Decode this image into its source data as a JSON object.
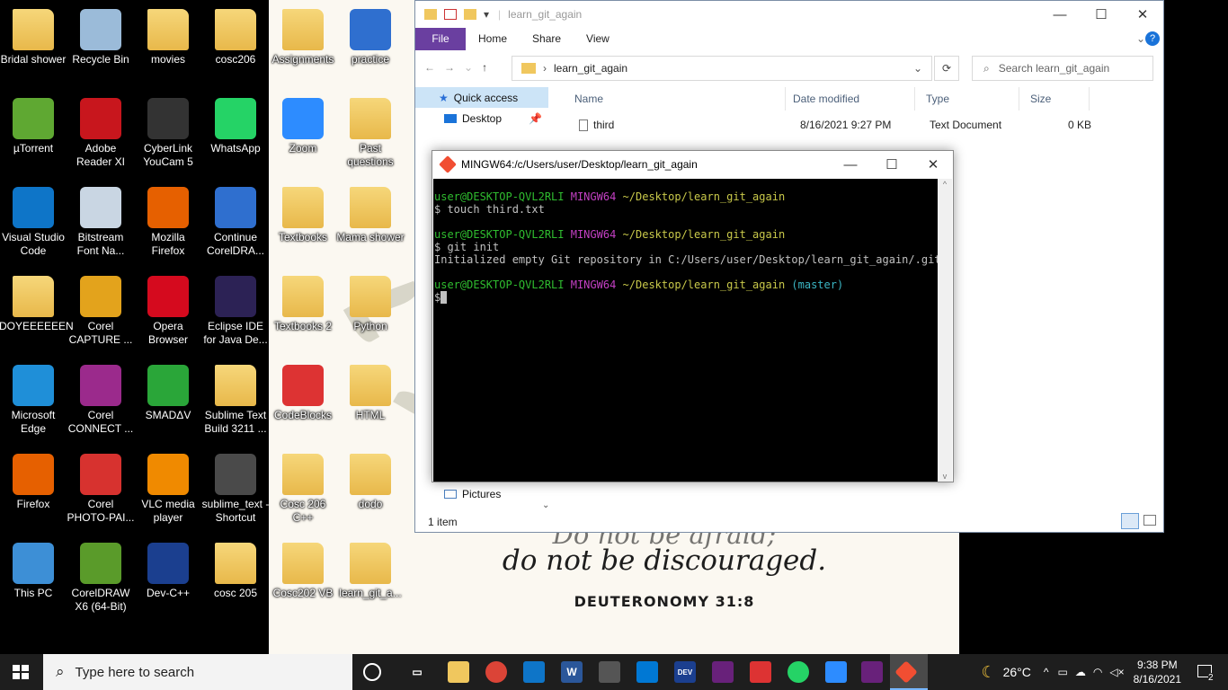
{
  "desktop_left_icons": [
    {
      "label": "Bridal shower",
      "icon": "image-folder-icon",
      "color": "#e9c06a"
    },
    {
      "label": "Recycle Bin",
      "icon": "recycle-bin-icon",
      "color": "#9bbbd9"
    },
    {
      "label": "movies",
      "icon": "folder-icon",
      "color": "#f0c75e"
    },
    {
      "label": "cosc206",
      "icon": "folder-icon",
      "color": "#f0c75e"
    },
    {
      "label": "µTorrent",
      "icon": "utorrent-icon",
      "color": "#5fa832"
    },
    {
      "label": "Adobe Reader XI",
      "icon": "adobe-reader-icon",
      "color": "#c8161d"
    },
    {
      "label": "CyberLink YouCam 5",
      "icon": "youcam-icon",
      "color": "#333333"
    },
    {
      "label": "WhatsApp",
      "icon": "whatsapp-icon",
      "color": "#25d366"
    },
    {
      "label": "Visual Studio Code",
      "icon": "vscode-icon",
      "color": "#0e75c8"
    },
    {
      "label": "Bitstream Font Na...",
      "icon": "font-navigator-icon",
      "color": "#c9d6e3"
    },
    {
      "label": "Mozilla Firefox",
      "icon": "firefox-icon",
      "color": "#e66000"
    },
    {
      "label": "Continue CorelDRA...",
      "icon": "document-icon",
      "color": "#2f6fcf"
    },
    {
      "label": "DOYEEEEEEN",
      "icon": "user-folder-icon",
      "color": "#e8b84a"
    },
    {
      "label": "Corel CAPTURE ...",
      "icon": "corel-capture-icon",
      "color": "#e3a31c"
    },
    {
      "label": "Opera Browser",
      "icon": "opera-icon",
      "color": "#d50a1e"
    },
    {
      "label": "Eclipse IDE for Java De...",
      "icon": "eclipse-icon",
      "color": "#2c2255"
    },
    {
      "label": "Microsoft Edge",
      "icon": "edge-icon",
      "color": "#1f8fd8"
    },
    {
      "label": "Corel CONNECT ...",
      "icon": "corel-connect-icon",
      "color": "#9b2a8c"
    },
    {
      "label": "SMADΔV",
      "icon": "smadav-icon",
      "color": "#2aa639"
    },
    {
      "label": "Sublime Text Build 3211 ...",
      "icon": "zip-folder-icon",
      "color": "#e8b84a"
    },
    {
      "label": "Firefox",
      "icon": "firefox-icon",
      "color": "#e66000"
    },
    {
      "label": "Corel PHOTO-PAI...",
      "icon": "corel-photopaint-icon",
      "color": "#d7322f"
    },
    {
      "label": "VLC media player",
      "icon": "vlc-icon",
      "color": "#f08a00"
    },
    {
      "label": "sublime_text - Shortcut",
      "icon": "sublime-icon",
      "color": "#4a4a4a"
    },
    {
      "label": "This PC",
      "icon": "this-pc-icon",
      "color": "#3d8fd6"
    },
    {
      "label": "CorelDRAW X6 (64-Bit)",
      "icon": "coreldraw-icon",
      "color": "#5a9b2a"
    },
    {
      "label": "Dev-C++",
      "icon": "devcpp-icon",
      "color": "#1b3f8f"
    },
    {
      "label": "cosc 205",
      "icon": "folder-icon",
      "color": "#e8b84a"
    }
  ],
  "desktop_right_icons": [
    {
      "label": "Assignments",
      "icon": "folder-icon",
      "color": "#e8b84a"
    },
    {
      "label": "practice",
      "icon": "screenshot-icon",
      "color": "#2f6fcf"
    },
    {
      "label": "Zoom",
      "icon": "zoom-icon",
      "color": "#2d8cff"
    },
    {
      "label": "Past questions",
      "icon": "folder-icon",
      "color": "#e8b84a"
    },
    {
      "label": "Textbooks",
      "icon": "folder-icon",
      "color": "#e8b84a"
    },
    {
      "label": "Mama shower",
      "icon": "image-folder-icon",
      "color": "#c99a6a"
    },
    {
      "label": "Textbooks 2",
      "icon": "folder-icon",
      "color": "#e8b84a"
    },
    {
      "label": "Python",
      "icon": "folder-icon",
      "color": "#e8b84a"
    },
    {
      "label": "CodeBlocks",
      "icon": "codeblocks-icon",
      "color": "#d33"
    },
    {
      "label": "HTML",
      "icon": "folder-icon",
      "color": "#e8b84a"
    },
    {
      "label": "Cosc 206 C++",
      "icon": "folder-icon",
      "color": "#e8b84a"
    },
    {
      "label": "dodo",
      "icon": "folder-icon",
      "color": "#e8b84a"
    },
    {
      "label": "Cosc202 VB",
      "icon": "folder-icon",
      "color": "#e8b84a"
    },
    {
      "label": "learn_git_a...",
      "icon": "folder-icon",
      "color": "#e8b84a"
    }
  ],
  "wallpaper": {
    "line1": "Do not be afraid;",
    "line2": "do not be discouraged.",
    "reference": "DEUTERONOMY 31:8"
  },
  "explorer": {
    "title": "learn_git_again",
    "ribbon_tabs": [
      "File",
      "Home",
      "Share",
      "View"
    ],
    "address": "learn_git_again",
    "search_placeholder": "Search learn_git_again",
    "nav_items": [
      {
        "label": "Quick access",
        "icon": "star-icon"
      },
      {
        "label": "Desktop",
        "icon": "desktop-icon"
      },
      {
        "label": "Pictures",
        "icon": "pictures-icon"
      }
    ],
    "columns": [
      "Name",
      "Date modified",
      "Type",
      "Size"
    ],
    "files": [
      {
        "name": "third",
        "date": "8/16/2021 9:27 PM",
        "type": "Text Document",
        "size": "0 KB"
      }
    ],
    "status": "1 item"
  },
  "terminal": {
    "title": "MINGW64:/c/Users/user/Desktop/learn_git_again",
    "user_host": "user@DESKTOP-QVL2RLI",
    "env": "MINGW64",
    "path": "~/Desktop/learn_git_again",
    "branch": "(master)",
    "cmd1": "$ touch third.txt",
    "cmd2": "$ git init",
    "output1": "Initialized empty Git repository in C:/Users/user/Desktop/learn_git_again/.git/",
    "prompt": "$"
  },
  "taskbar": {
    "search_placeholder": "Type here to search",
    "temperature": "26°C",
    "time": "9:38 PM",
    "date": "8/16/2021",
    "notification_count": "2"
  }
}
